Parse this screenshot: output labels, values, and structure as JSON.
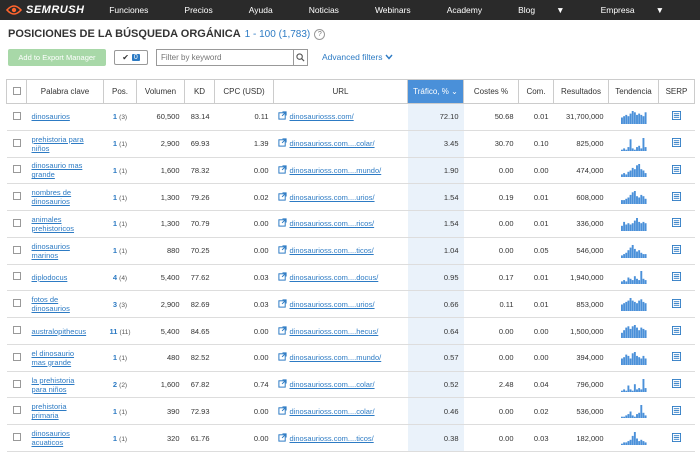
{
  "brand": {
    "name": "SEMRUSH"
  },
  "nav": [
    {
      "label": "Funciones",
      "caret": false
    },
    {
      "label": "Precios",
      "caret": false
    },
    {
      "label": "Ayuda",
      "caret": false
    },
    {
      "label": "Noticias",
      "caret": false
    },
    {
      "label": "Webinars",
      "caret": false
    },
    {
      "label": "Academy",
      "caret": false
    },
    {
      "label": "Blog",
      "caret": true
    },
    {
      "label": "Empresa",
      "caret": true
    }
  ],
  "page": {
    "title": "POSICIONES DE LA BÚSQUEDA ORGÁNICA",
    "range": "1 - 100 (1,783)"
  },
  "controls": {
    "export_label": "Add to Export Manager",
    "check_count": "0",
    "filter_placeholder": "Filter by keyword",
    "advanced_label": "Advanced filters"
  },
  "columns": [
    "Palabra clave",
    "Pos.",
    "Volumen",
    "KD",
    "CPC (USD)",
    "URL",
    "Tráfico, %",
    "Costes %",
    "Com.",
    "Resultados",
    "Tendencia",
    "SERP"
  ],
  "colors": {
    "accent": "#2d7bc4",
    "sorted_header": "#4a90d9",
    "trend_bar": "#4a90d9",
    "export_button": "#a8d8a8"
  },
  "rows": [
    {
      "keyword_line1": "dinosaurios",
      "keyword_line2": "",
      "pos": "1",
      "pos_prev": "(3)",
      "volume": "60,500",
      "kd": "83.14",
      "cpc": "0.11",
      "url": "dinosauriosss.com/",
      "traffic": "72.10",
      "costs": "50.68",
      "com": "0.01",
      "results": "31,700,000",
      "trend": [
        0.5,
        0.6,
        0.7,
        0.6,
        0.8,
        1,
        0.9,
        0.7,
        0.8,
        0.7,
        0.6,
        0.9
      ]
    },
    {
      "keyword_line1": "prehistoria para",
      "keyword_line2": "niños",
      "pos": "1",
      "pos_prev": "(1)",
      "volume": "2,900",
      "kd": "69.93",
      "cpc": "1.39",
      "url": "dinosaurioss.com....colar/",
      "traffic": "3.45",
      "costs": "30.70",
      "com": "0.10",
      "results": "825,000",
      "trend": [
        0.1,
        0.2,
        0.1,
        0.3,
        0.9,
        0.2,
        0.1,
        0.3,
        0.4,
        0.2,
        1,
        0.3
      ]
    },
    {
      "keyword_line1": "dinosaurio mas",
      "keyword_line2": "grande",
      "pos": "1",
      "pos_prev": "(1)",
      "volume": "1,600",
      "kd": "78.32",
      "cpc": "0.00",
      "url": "dinosaurioss.com....mundo/",
      "traffic": "1.90",
      "costs": "0.00",
      "com": "0.00",
      "results": "474,000",
      "trend": [
        0.2,
        0.3,
        0.2,
        0.4,
        0.5,
        0.7,
        0.6,
        0.9,
        1,
        0.6,
        0.5,
        0.3
      ]
    },
    {
      "keyword_line1": "nombres de",
      "keyword_line2": "dinosaurios",
      "pos": "1",
      "pos_prev": "(1)",
      "volume": "1,300",
      "kd": "79.26",
      "cpc": "0.02",
      "url": "dinosaurioss.com....urios/",
      "traffic": "1.54",
      "costs": "0.19",
      "com": "0.01",
      "results": "608,000",
      "trend": [
        0.3,
        0.3,
        0.4,
        0.5,
        0.7,
        0.9,
        1,
        0.6,
        0.5,
        0.7,
        0.6,
        0.4
      ]
    },
    {
      "keyword_line1": "animales",
      "keyword_line2": "prehistoricos",
      "pos": "1",
      "pos_prev": "(1)",
      "volume": "1,300",
      "kd": "70.79",
      "cpc": "0.00",
      "url": "dinosaurioss.com....ricos/",
      "traffic": "1.54",
      "costs": "0.00",
      "com": "0.01",
      "results": "336,000",
      "trend": [
        0.4,
        0.7,
        0.5,
        0.6,
        0.5,
        0.6,
        0.8,
        1,
        0.7,
        0.6,
        0.7,
        0.6
      ]
    },
    {
      "keyword_line1": "dinosaurios",
      "keyword_line2": "marinos",
      "pos": "1",
      "pos_prev": "(1)",
      "volume": "880",
      "kd": "70.25",
      "cpc": "0.00",
      "url": "dinosaurioss.com....ticos/",
      "traffic": "1.04",
      "costs": "0.00",
      "com": "0.05",
      "results": "546,000",
      "trend": [
        0.2,
        0.3,
        0.4,
        0.6,
        0.8,
        1,
        0.7,
        0.5,
        0.6,
        0.4,
        0.3,
        0.3
      ]
    },
    {
      "keyword_line1": "diplodocus",
      "keyword_line2": "",
      "pos": "4",
      "pos_prev": "(4)",
      "volume": "5,400",
      "kd": "77.62",
      "cpc": "0.03",
      "url": "dinosaurioss.com....docus/",
      "traffic": "0.95",
      "costs": "0.17",
      "com": "0.01",
      "results": "1,940,000",
      "trend": [
        0.2,
        0.3,
        0.2,
        0.5,
        0.4,
        0.3,
        0.6,
        0.4,
        0.3,
        1,
        0.4,
        0.3
      ]
    },
    {
      "keyword_line1": "fotos de",
      "keyword_line2": "dinosaurios",
      "pos": "3",
      "pos_prev": "(3)",
      "volume": "2,900",
      "kd": "82.69",
      "cpc": "0.03",
      "url": "dinosaurioss.com....urios/",
      "traffic": "0.66",
      "costs": "0.11",
      "com": "0.01",
      "results": "853,000",
      "trend": [
        0.5,
        0.6,
        0.7,
        0.8,
        1,
        0.8,
        0.7,
        0.6,
        0.8,
        0.9,
        0.7,
        0.6
      ]
    },
    {
      "keyword_line1": "australopithecus",
      "keyword_line2": "",
      "pos": "11",
      "pos_prev": "(11)",
      "volume": "5,400",
      "kd": "84.65",
      "cpc": "0.00",
      "url": "dinosaurioss.com....hecus/",
      "traffic": "0.64",
      "costs": "0.00",
      "com": "0.00",
      "results": "1,500,000",
      "trend": [
        0.4,
        0.6,
        0.8,
        0.9,
        0.7,
        0.9,
        1,
        0.8,
        0.6,
        0.8,
        0.7,
        0.6
      ]
    },
    {
      "keyword_line1": "el dinosaurio",
      "keyword_line2": "mas grande",
      "pos": "1",
      "pos_prev": "(1)",
      "volume": "480",
      "kd": "82.52",
      "cpc": "0.00",
      "url": "dinosaurioss.com....mundo/",
      "traffic": "0.57",
      "costs": "0.00",
      "com": "0.00",
      "results": "394,000",
      "trend": [
        0.5,
        0.6,
        0.8,
        0.7,
        0.5,
        0.9,
        1,
        0.7,
        0.6,
        0.5,
        0.7,
        0.5
      ]
    },
    {
      "keyword_line1": "la prehistoria",
      "keyword_line2": "para niños",
      "pos": "2",
      "pos_prev": "(2)",
      "volume": "1,600",
      "kd": "67.82",
      "cpc": "0.74",
      "url": "dinosaurioss.com....colar/",
      "traffic": "0.52",
      "costs": "2.48",
      "com": "0.04",
      "results": "796,000",
      "trend": [
        0.1,
        0.2,
        0.1,
        0.5,
        0.2,
        0.1,
        0.6,
        0.2,
        0.3,
        0.2,
        1,
        0.3
      ]
    },
    {
      "keyword_line1": "prehistoria",
      "keyword_line2": "primaria",
      "pos": "1",
      "pos_prev": "(1)",
      "volume": "390",
      "kd": "72.93",
      "cpc": "0.00",
      "url": "dinosaurioss.com....colar/",
      "traffic": "0.46",
      "costs": "0.00",
      "com": "0.02",
      "results": "536,000",
      "trend": [
        0.1,
        0.1,
        0.2,
        0.3,
        0.5,
        0.2,
        0.1,
        0.3,
        0.4,
        1,
        0.4,
        0.2
      ]
    },
    {
      "keyword_line1": "dinosaurios",
      "keyword_line2": "acuaticos",
      "pos": "1",
      "pos_prev": "(1)",
      "volume": "320",
      "kd": "61.76",
      "cpc": "0.00",
      "url": "dinosaurioss.com....ticos/",
      "traffic": "0.38",
      "costs": "0.00",
      "com": "0.03",
      "results": "182,000",
      "trend": [
        0.1,
        0.2,
        0.2,
        0.3,
        0.4,
        0.7,
        1,
        0.5,
        0.3,
        0.4,
        0.3,
        0.2
      ]
    }
  ]
}
